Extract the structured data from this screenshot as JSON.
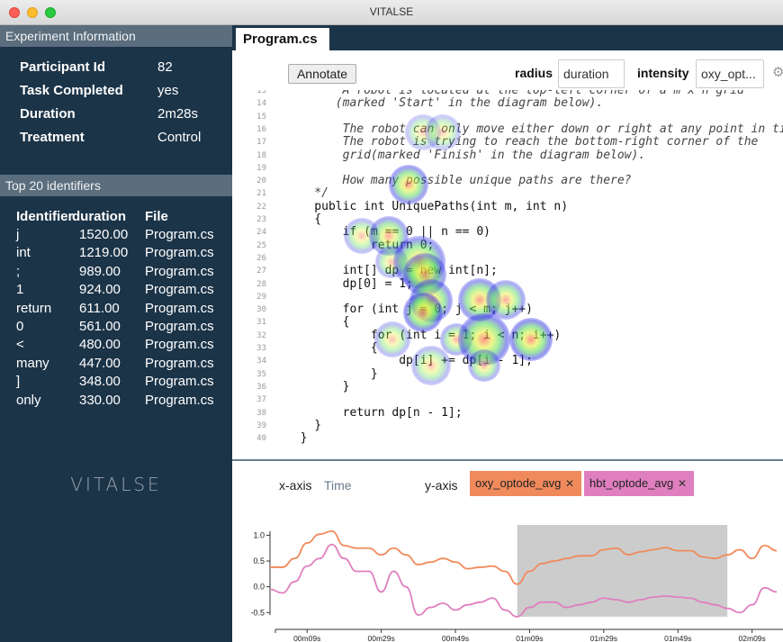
{
  "window": {
    "title": "VITALSE"
  },
  "sidebar": {
    "info_header": "Experiment Information",
    "info": [
      {
        "label": "Participant Id",
        "value": "82"
      },
      {
        "label": "Task Completed",
        "value": "yes"
      },
      {
        "label": "Duration",
        "value": "2m28s"
      },
      {
        "label": "Treatment",
        "value": "Control"
      }
    ],
    "identifiers_header": "Top 20 identifiers",
    "identifier_columns": [
      "Identifier",
      "duration",
      "File"
    ],
    "identifiers": [
      {
        "id": "j",
        "duration": "1520.00",
        "file": "Program.cs"
      },
      {
        "id": "int",
        "duration": "1219.00",
        "file": "Program.cs"
      },
      {
        "id": ";",
        "duration": "989.00",
        "file": "Program.cs"
      },
      {
        "id": "1",
        "duration": "924.00",
        "file": "Program.cs"
      },
      {
        "id": "return",
        "duration": "611.00",
        "file": "Program.cs"
      },
      {
        "id": "0",
        "duration": "561.00",
        "file": "Program.cs"
      },
      {
        "id": "<",
        "duration": "480.00",
        "file": "Program.cs"
      },
      {
        "id": "many",
        "duration": "447.00",
        "file": "Program.cs"
      },
      {
        "id": "]",
        "duration": "348.00",
        "file": "Program.cs"
      },
      {
        "id": "only",
        "duration": "330.00",
        "file": "Program.cs"
      }
    ],
    "brand": "VITALSE"
  },
  "editor": {
    "tab": "Program.cs",
    "annotate_label": "Annotate",
    "radius_label": "radius",
    "radius_value": "duration",
    "intensity_label": "intensity",
    "intensity_value": "oxy_opt...",
    "gear_icon": "gear-icon",
    "code_lines": [
      {
        "n": "13",
        "text": "        A robot is located at the top-left corner of a m x n grid",
        "kind": "comment"
      },
      {
        "n": "14",
        "text": "       (marked 'Start' in the diagram below).",
        "kind": "comment"
      },
      {
        "n": "15",
        "text": "",
        "kind": "plain"
      },
      {
        "n": "16",
        "text": "        The robot can only move either down or right at any point in time.",
        "kind": "comment"
      },
      {
        "n": "17",
        "text": "        The robot is trying to reach the bottom-right corner of the",
        "kind": "comment"
      },
      {
        "n": "18",
        "text": "        grid(marked 'Finish' in the diagram below).",
        "kind": "comment"
      },
      {
        "n": "19",
        "text": "",
        "kind": "plain"
      },
      {
        "n": "20",
        "text": "        How many possible unique paths are there?",
        "kind": "comment"
      },
      {
        "n": "21",
        "text": "    */",
        "kind": "comment"
      },
      {
        "n": "22",
        "text": "    public int UniquePaths(int m, int n)",
        "kind": "plain"
      },
      {
        "n": "23",
        "text": "    {",
        "kind": "plain"
      },
      {
        "n": "24",
        "text": "        if (m == 0 || n == 0)",
        "kind": "plain"
      },
      {
        "n": "25",
        "text": "            return 0;",
        "kind": "plain"
      },
      {
        "n": "26",
        "text": "",
        "kind": "plain"
      },
      {
        "n": "27",
        "text": "        int[] dp = new int[n];",
        "kind": "plain"
      },
      {
        "n": "28",
        "text": "        dp[0] = 1;",
        "kind": "plain"
      },
      {
        "n": "29",
        "text": "",
        "kind": "plain"
      },
      {
        "n": "30",
        "text": "        for (int j = 0; j < m; j++)",
        "kind": "plain"
      },
      {
        "n": "31",
        "text": "        {",
        "kind": "plain"
      },
      {
        "n": "32",
        "text": "            for (int i = 1; i < n; i++)",
        "kind": "plain"
      },
      {
        "n": "33",
        "text": "            {",
        "kind": "plain"
      },
      {
        "n": "34",
        "text": "                dp[i] += dp[i - 1];",
        "kind": "plain"
      },
      {
        "n": "35",
        "text": "            }",
        "kind": "plain"
      },
      {
        "n": "36",
        "text": "        }",
        "kind": "plain"
      },
      {
        "n": "37",
        "text": "",
        "kind": "plain"
      },
      {
        "n": "38",
        "text": "        return dp[n - 1];",
        "kind": "plain"
      },
      {
        "n": "39",
        "text": "    }",
        "kind": "plain"
      },
      {
        "n": "40",
        "text": "  }",
        "kind": "plain"
      }
    ]
  },
  "axes": {
    "x_label": "x-axis",
    "x_value": "Time",
    "y_label": "y-axis",
    "y_chips": [
      {
        "label": "oxy_optode_avg",
        "color": "#f08a5c"
      },
      {
        "label": "hbt_optode_avg",
        "color": "#e07fbf"
      }
    ],
    "remove_icon": "close-icon"
  },
  "colors": {
    "sidebar_bg": "#1c3448",
    "header_bg": "#5a6e7e",
    "oxy_line": "#f08a5c",
    "hbt_line": "#e07fbf",
    "selection": "#cccccc"
  },
  "chart_data": {
    "type": "line",
    "x": [
      "00m09s",
      "00m29s",
      "00m49s",
      "01m09s",
      "01m29s",
      "01m49s",
      "02m09s"
    ],
    "y_ticks": [
      1.0,
      0.5,
      0.0,
      -0.5
    ],
    "ylim": [
      -0.6,
      1.2
    ],
    "selection": [
      80,
      148
    ],
    "series": [
      {
        "name": "oxy_optode_avg",
        "color": "#f08a5c",
        "points": [
          [
            0,
            0.38
          ],
          [
            4,
            0.38
          ],
          [
            8,
            0.55
          ],
          [
            12,
            0.85
          ],
          [
            16,
            1.02
          ],
          [
            20,
            1.08
          ],
          [
            24,
            0.8
          ],
          [
            28,
            0.75
          ],
          [
            32,
            0.75
          ],
          [
            36,
            0.62
          ],
          [
            40,
            0.75
          ],
          [
            44,
            0.62
          ],
          [
            48,
            0.43
          ],
          [
            52,
            0.48
          ],
          [
            56,
            0.55
          ],
          [
            60,
            0.48
          ],
          [
            64,
            0.35
          ],
          [
            68,
            0.38
          ],
          [
            72,
            0.4
          ],
          [
            76,
            0.3
          ],
          [
            80,
            0.05
          ],
          [
            84,
            0.3
          ],
          [
            88,
            0.45
          ],
          [
            92,
            0.5
          ],
          [
            96,
            0.55
          ],
          [
            100,
            0.6
          ],
          [
            104,
            0.6
          ],
          [
            108,
            0.72
          ],
          [
            112,
            0.75
          ],
          [
            116,
            0.62
          ],
          [
            120,
            0.68
          ],
          [
            124,
            0.72
          ],
          [
            128,
            0.76
          ],
          [
            132,
            0.7
          ],
          [
            136,
            0.7
          ],
          [
            140,
            0.58
          ],
          [
            144,
            0.55
          ],
          [
            148,
            0.62
          ],
          [
            152,
            0.72
          ],
          [
            156,
            0.55
          ],
          [
            160,
            0.8
          ],
          [
            164,
            0.7
          ]
        ]
      },
      {
        "name": "hbt_optode_avg",
        "color": "#e07fbf",
        "points": [
          [
            0,
            -0.05
          ],
          [
            4,
            -0.12
          ],
          [
            8,
            0.1
          ],
          [
            12,
            0.4
          ],
          [
            16,
            0.55
          ],
          [
            20,
            0.82
          ],
          [
            24,
            0.55
          ],
          [
            28,
            0.3
          ],
          [
            32,
            0.3
          ],
          [
            36,
            -0.1
          ],
          [
            40,
            0.3
          ],
          [
            44,
            0.0
          ],
          [
            48,
            -0.55
          ],
          [
            52,
            -0.4
          ],
          [
            56,
            -0.32
          ],
          [
            60,
            -0.45
          ],
          [
            64,
            -0.35
          ],
          [
            68,
            -0.3
          ],
          [
            72,
            -0.22
          ],
          [
            76,
            -0.45
          ],
          [
            80,
            -0.58
          ],
          [
            84,
            -0.4
          ],
          [
            88,
            -0.3
          ],
          [
            92,
            -0.3
          ],
          [
            96,
            -0.4
          ],
          [
            100,
            -0.35
          ],
          [
            104,
            -0.3
          ],
          [
            108,
            -0.22
          ],
          [
            112,
            -0.25
          ],
          [
            116,
            -0.3
          ],
          [
            120,
            -0.25
          ],
          [
            124,
            -0.2
          ],
          [
            128,
            -0.18
          ],
          [
            132,
            -0.2
          ],
          [
            136,
            -0.22
          ],
          [
            140,
            -0.3
          ],
          [
            144,
            -0.35
          ],
          [
            148,
            -0.42
          ],
          [
            152,
            -0.5
          ],
          [
            156,
            -0.35
          ],
          [
            160,
            -0.02
          ],
          [
            164,
            -0.1
          ]
        ]
      }
    ]
  }
}
